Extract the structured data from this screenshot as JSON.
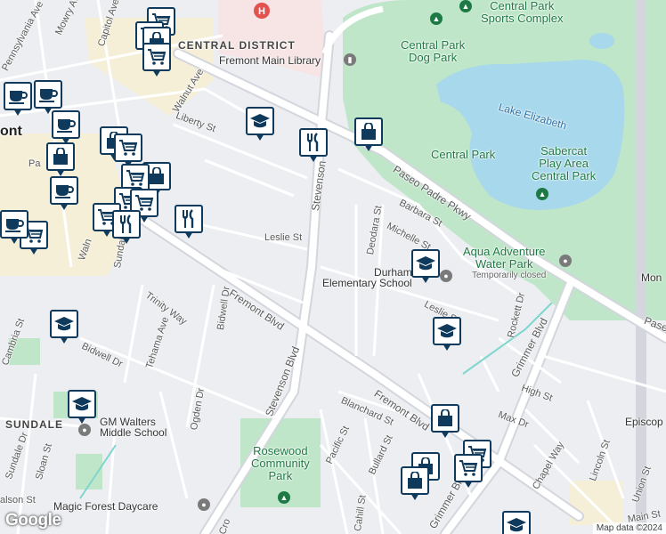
{
  "map": {
    "attribution": "Map data ©2024",
    "logo": "Google"
  },
  "areas": {
    "central_district": "CENTRAL DISTRICT",
    "sundale": "SUNDALE",
    "fremont_partial": "ont"
  },
  "places": {
    "sports_complex": "Central Park\nSports Complex",
    "dog_park": "Central Park\nDog Park",
    "lake": "Lake Elizabeth",
    "central_park": "Central Park",
    "sabercat": "Sabercat\nPlay Area\nCentral Park",
    "aqua_adventure": "Aqua Adventure\nWater Park",
    "temporarily_closed": "Temporarily closed",
    "main_library": "Fremont Main Library",
    "durham_school": "Durham\nElementary School",
    "gm_walters": "GM Walters\nMiddle School",
    "rosewood_park": "Rosewood\nCommunity\nPark",
    "magic_forest": "Magic Forest Daycare",
    "episcopal": "Episcop",
    "mon": "Mon"
  },
  "streets": {
    "fremont_blvd_1": "Fremont Blvd",
    "fremont_blvd_2": "Fremont Blvd",
    "paseo_padre": "Paseo Padre Pkwy",
    "paseo_short": "Pase",
    "stevenson_blvd": "Stevenson Blvd",
    "stevenson": "Stevenson",
    "walnut_ave": "Walnut Ave",
    "liberty_st": "Liberty St",
    "leslie_st": "Leslie St",
    "leslie_st_2": "Leslie St",
    "barbara_st": "Barbara St",
    "michelle_st": "Michelle St",
    "deodara_st": "Deodara St",
    "trinity_way": "Trinity Way",
    "bidwell_dr": "Bidwell Dr",
    "bidwell_dr_2": "Bidwell Dr",
    "tehama_ave": "Tehama Ave",
    "ogden_dr": "Ogden Dr",
    "sundale_dr": "Sundale Dr",
    "sundale_dr_2": "Sundale Dr",
    "sloan_st": "Sloan St",
    "cambria_st": "Cambria St",
    "blanchard_st": "Blanchard St",
    "pacific_st": "Pacific St",
    "bullard_st": "Bullard St",
    "cahill_st": "Cahill St",
    "grimmer_blvd": "Grimmer Blvd",
    "grimmer_blvd_2": "Grimmer Blvd",
    "rockett_dr": "Rockett Dr",
    "high_st": "High St",
    "max_dr": "Max Dr",
    "chapel_way": "Chapel Way",
    "lincoln_st": "Lincoln St",
    "union_st": "Union St",
    "main_st": "Main St",
    "mowry_ave": "Mowry Av",
    "capitol_ave": "Capitol Ave",
    "pennsylvania_ave": "Pennsylvania Ave",
    "walnut_short": "Waln",
    "cro": "Cro",
    "alson": "alson St",
    "pa": "Pa"
  },
  "markers": [
    {
      "name": "grocery-marker",
      "icon": "cart"
    },
    {
      "name": "shopping-marker",
      "icon": "bag"
    },
    {
      "name": "cafe-marker",
      "icon": "cup"
    },
    {
      "name": "restaurant-marker",
      "icon": "fork-knife"
    },
    {
      "name": "school-marker",
      "icon": "mortarboard"
    }
  ],
  "colors": {
    "park": "#bfe6c8",
    "water": "#a8d8ec",
    "road": "#ffffff",
    "highway_edge": "#c8ccd4",
    "marker_border": "#0f3a5c"
  }
}
